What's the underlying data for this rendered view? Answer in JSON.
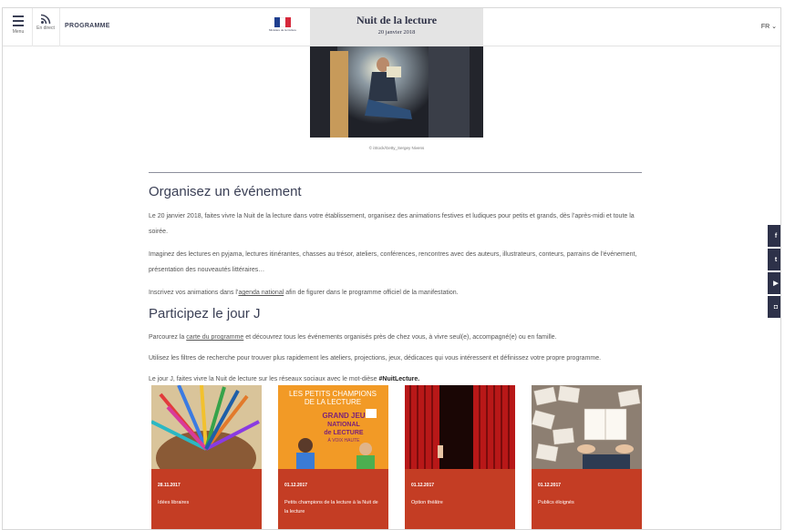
{
  "header": {
    "menu_label": "Menu",
    "direct_label": "En direct",
    "programme_label": "PROGRAMME",
    "logo_text": "Ministère de la Culture",
    "site_title": "Nuit de la lecture",
    "site_date": "20 janvier 2018",
    "language": "FR ⌄"
  },
  "hero": {
    "credit": "© iStock/Getty_Sergey Nivens"
  },
  "section1": {
    "title": "Organisez un événement",
    "p1": "Le 20 janvier 2018, faites vivre la Nuit de la lecture dans votre établissement, organisez des animations festives et ludiques pour petits et grands, dès l’après-midi et toute la soirée.",
    "p2": "Imaginez des lectures en pyjama, lectures itinérantes, chasses au trésor, ateliers, conférences, rencontres avec des auteurs, illustrateurs, conteurs, parrains de l’événement, présentation des nouveautés littéraires…",
    "p3_before": "Inscrivez vos animations dans l’",
    "p3_link": "agenda national",
    "p3_after": " afin de figurer dans le programme officiel de la manifestation."
  },
  "section2": {
    "title": "Participez le jour J",
    "p1_before": "Parcourez la ",
    "p1_link": "carte du programme",
    "p1_after": " et découvrez tous les événements organisés près de chez vous, à vivre seul(e), accompagné(e) ou en famille.",
    "p2": "Utilisez les filtres de recherche pour trouver plus rapidement les ateliers, projections, jeux, dédicaces qui vous intéressent et définissez votre propre programme.",
    "p3_before": "Le jour J, faites vivre la Nuit de lecture sur les réseaux sociaux avec le mot-dièse ",
    "p3_hashtag": "#NuitLecture."
  },
  "cards": [
    {
      "date": "28.11.2017",
      "title": "Idées libraires"
    },
    {
      "date": "01.12.2017",
      "title": "Petits champions de la lecture à la Nuit de la lecture",
      "poster_line1": "LES PETITS CHAMPIONS",
      "poster_line2": "DE LA LECTURE",
      "poster_line3": "GRAND JEU",
      "poster_line4": "NATIONAL",
      "poster_line5": "de LECTURE",
      "poster_line6": "À VOIX HAUTE"
    },
    {
      "date": "01.12.2017",
      "title": "Option théâtre"
    },
    {
      "date": "01.12.2017",
      "title": "Publics éloignés"
    }
  ],
  "social": {
    "facebook": "f",
    "twitter": "t",
    "youtube": "▶",
    "instagram": "◘"
  },
  "colors": {
    "accent_red": "#c43d24",
    "navy": "#2d3149",
    "title_box": "#e4e4e4"
  }
}
